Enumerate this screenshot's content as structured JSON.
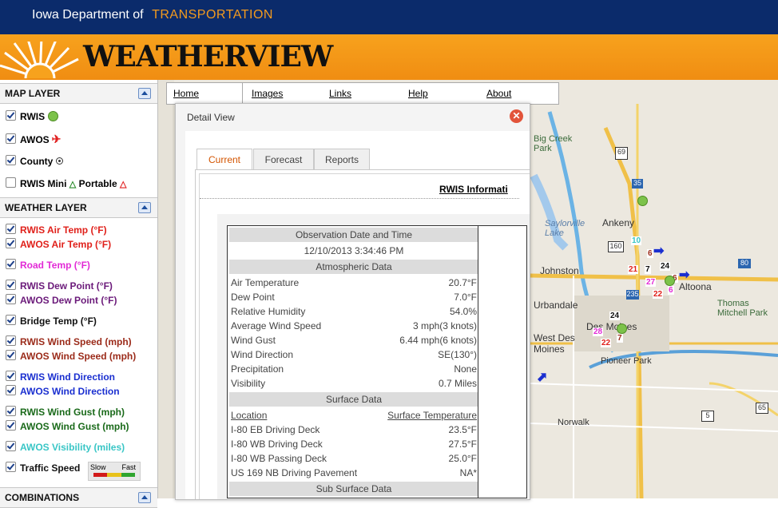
{
  "header": {
    "org_name": "Iowa Department of",
    "org_name_accent": "TRANSPORTATION",
    "app_title": "WEATHERVIEW"
  },
  "sidebar": {
    "map_layer_title": "MAP LAYER",
    "weather_layer_title": "WEATHER LAYER",
    "combinations_title": "COMBINATIONS",
    "map_layers": [
      {
        "label": "RWIS",
        "checked": true
      },
      {
        "label": "AWOS",
        "checked": true
      },
      {
        "label": "County",
        "checked": true
      },
      {
        "label": "RWIS Mini",
        "checked": false
      },
      {
        "label": "Portable",
        "checked": false
      }
    ],
    "weather_layers": [
      {
        "label": "RWIS Air Temp (°F)",
        "color": "#e0201a"
      },
      {
        "label": "AWOS Air Temp (°F)",
        "color": "#e0201a"
      },
      {
        "label": "Road Temp (°F)",
        "color": "#e22ad6"
      },
      {
        "label": "RWIS Dew Point (°F)",
        "color": "#6b1a7a"
      },
      {
        "label": "AWOS Dew Point (°F)",
        "color": "#6b1a7a"
      },
      {
        "label": "Bridge Temp (°F)",
        "color": "#111111"
      },
      {
        "label": "RWIS Wind Speed (mph)",
        "color": "#9b2b1a"
      },
      {
        "label": "AWOS Wind Speed (mph)",
        "color": "#9b2b1a"
      },
      {
        "label": "RWIS Wind Direction",
        "color": "#1a2fd0"
      },
      {
        "label": "AWOS Wind Direction",
        "color": "#1a2fd0"
      },
      {
        "label": "RWIS Wind Gust (mph)",
        "color": "#1a6a1a"
      },
      {
        "label": "AWOS Wind Gust (mph)",
        "color": "#1a6a1a"
      },
      {
        "label": "AWOS Visibility (miles)",
        "color": "#39c6c6"
      },
      {
        "label": "Traffic Speed",
        "color": "#111111"
      }
    ],
    "speed_legend": {
      "slow": "Slow",
      "fast": "Fast"
    }
  },
  "nav": {
    "items": [
      "Home",
      "Images",
      "Links",
      "Help",
      "About"
    ]
  },
  "detail": {
    "title": "Detail View",
    "tabs": [
      "Current",
      "Forecast",
      "Reports"
    ],
    "info_heading": "RWIS Informati",
    "observation_header": "Observation Date and Time",
    "observation_time": "12/10/2013 3:34:46 PM",
    "atmos_header": "Atmospheric Data",
    "atmos": [
      {
        "label": "Air Temperature",
        "value": "20.7°F"
      },
      {
        "label": "Dew Point",
        "value": "7.0°F"
      },
      {
        "label": "Relative Humidity",
        "value": "54.0%"
      },
      {
        "label": "Average Wind Speed",
        "value": "3 mph(3 knots)"
      },
      {
        "label": "Wind Gust",
        "value": "6.44 mph(6 knots)"
      },
      {
        "label": "Wind Direction",
        "value": "SE(130°)"
      },
      {
        "label": "Precipitation",
        "value": "None"
      },
      {
        "label": "Visibility",
        "value": "0.7 Miles"
      }
    ],
    "surface_header": "Surface Data",
    "surface_col_location": "Location",
    "surface_col_temp": "Surface Temperature",
    "surface": [
      {
        "label": "I-80 EB Driving Deck",
        "value": "23.5°F"
      },
      {
        "label": "I-80 WB Driving Deck",
        "value": "27.5°F"
      },
      {
        "label": "I-80 WB Passing Deck",
        "value": "25.0°F"
      },
      {
        "label": "US 169 NB Driving Pavement",
        "value": "NA*"
      }
    ],
    "subsurface_header": "Sub Surface Data"
  },
  "map": {
    "places": [
      "Ankeny",
      "Johnston",
      "Urbandale",
      "West Des Moines",
      "Des Moines",
      "Altoona",
      "Pioneer Park",
      "Norwalk",
      "Thomas Mitchell Park",
      "Saylorville Lake",
      "Big Creek Park"
    ],
    "highway_shields": [
      "69",
      "35",
      "160",
      "235",
      "80",
      "5",
      "65"
    ],
    "readings": [
      "10",
      "6",
      "7",
      "21",
      "24",
      "27",
      "6",
      "22",
      "6",
      "24",
      "7",
      "28",
      "22"
    ]
  }
}
